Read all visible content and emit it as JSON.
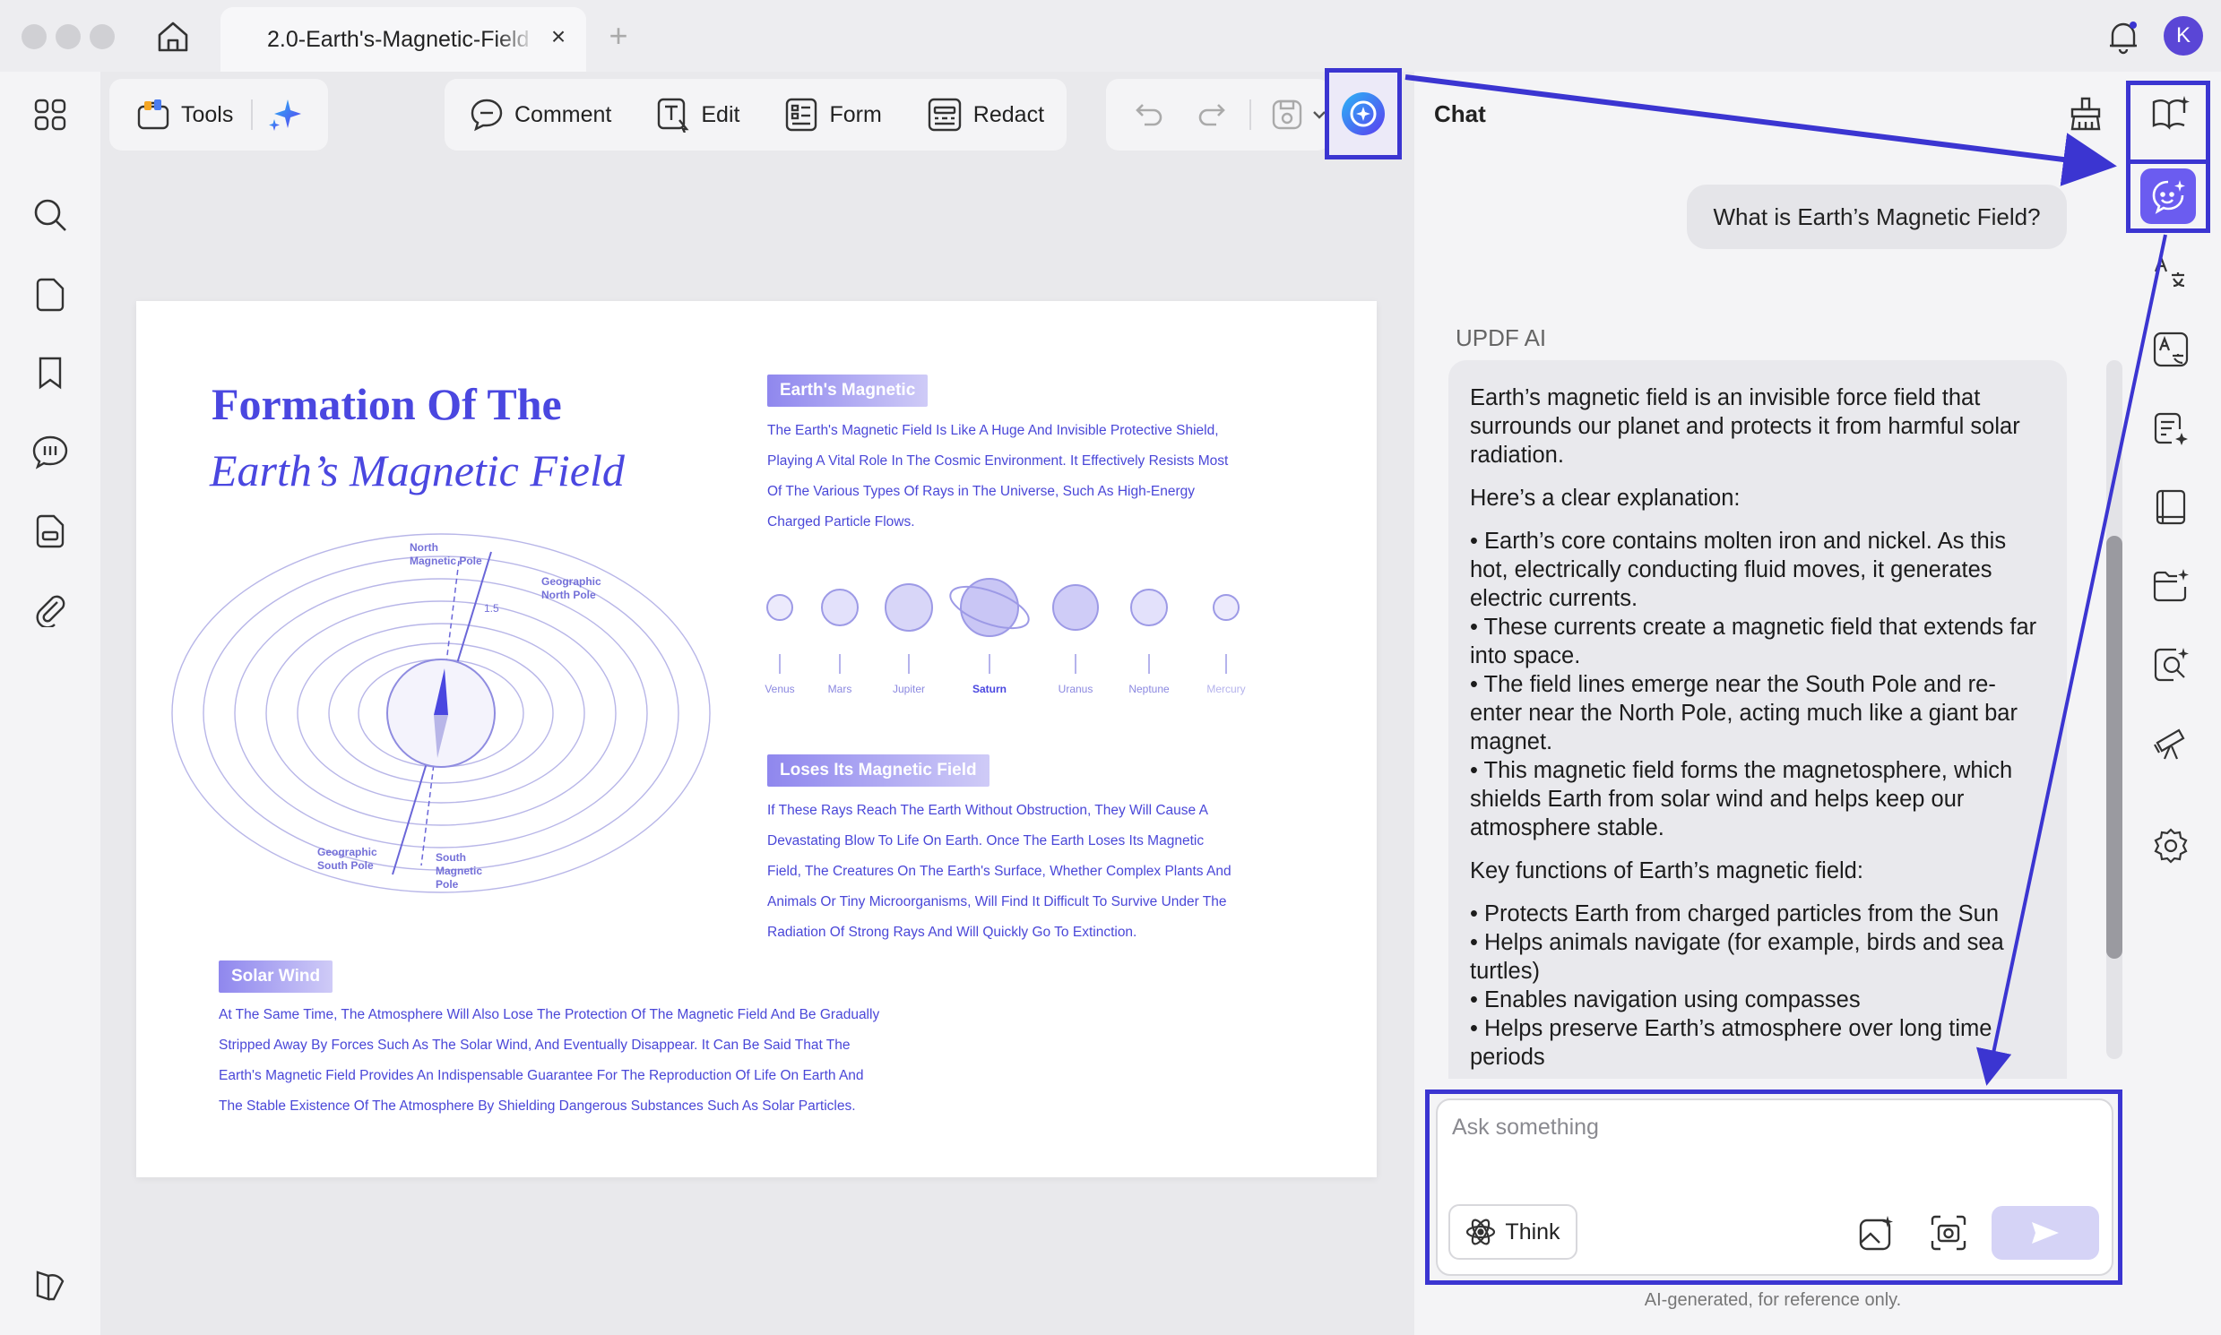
{
  "tab": {
    "title": "2.0-Earth's-Magnetic-Field",
    "close": "×",
    "add": "+"
  },
  "user": {
    "initial": "K"
  },
  "toolbar": {
    "tools_label": "Tools",
    "comment_label": "Comment",
    "edit_label": "Edit",
    "form_label": "Form",
    "redact_label": "Redact"
  },
  "document": {
    "title_line1": "Formation Of The",
    "title_line2": "Earth’s Magnetic Field",
    "sections": [
      {
        "label": "Earth's Magnetic",
        "lines": [
          "The Earth's Magnetic Field Is Like A Huge And Invisible Protective Shield,",
          "Playing A Vital Role In The Cosmic Environment. It Effectively Resists Most",
          "Of The Various Types Of Rays in The Universe, Such As High-Energy",
          "Charged Particle Flows."
        ]
      },
      {
        "label": "Loses Its Magnetic Field",
        "lines": [
          "If These Rays Reach The Earth Without Obstruction, They Will Cause A",
          "Devastating Blow To Life On Earth. Once The Earth Loses Its Magnetic",
          "Field, The Creatures On The Earth's Surface, Whether Complex Plants And",
          "Animals Or Tiny Microorganisms, Will Find It Difficult To Survive Under The",
          "Radiation Of Strong Rays And Will Quickly Go To Extinction."
        ]
      },
      {
        "label": "Solar Wind",
        "lines": [
          "At The Same Time, The Atmosphere Will Also Lose The Protection Of The Magnetic Field And Be Gradually",
          "Stripped Away By Forces Such As The Solar Wind, And Eventually Disappear. It Can Be Said That The",
          "Earth's Magnetic Field Provides An Indispensable Guarantee For The Reproduction Of Life On Earth And",
          "The Stable Existence Of The Atmosphere By Shielding Dangerous Substances Such As Solar Particles."
        ]
      }
    ],
    "planets": [
      "Venus",
      "Mars",
      "Jupiter",
      "Saturn",
      "Uranus",
      "Neptune",
      "Mercury"
    ],
    "diagram_labels": {
      "north_magnetic": [
        "North",
        "Magnetic Pole"
      ],
      "geo_north": [
        "Geographic",
        "North Pole"
      ],
      "geo_south": [
        "Geographic",
        "South Pole"
      ],
      "south_magnetic": [
        "South",
        "Magnetic",
        "Pole"
      ],
      "angle": "1.5"
    }
  },
  "chat": {
    "title": "Chat",
    "user_question": "What is Earth’s Magnetic Field?",
    "ai_sender": "UPDF AI",
    "ai_intro": "Earth’s magnetic field is an invisible force field that surrounds our planet and protects it from harmful solar radiation.",
    "ai_explain_heading": "Here’s a clear explanation:",
    "ai_bullets": [
      "• Earth’s core contains molten iron and nickel. As this hot, electrically conducting fluid moves, it generates electric currents.",
      "• These currents create a magnetic field that extends far into space.",
      "• The field lines emerge near the South Pole and re-enter near the North Pole, acting much like a giant bar magnet.",
      "• This magnetic field forms the magnetosphere, which shields Earth from solar wind and helps keep our atmosphere stable."
    ],
    "ai_functions_heading": "Key functions of Earth’s magnetic field:",
    "ai_functions": [
      "• Protects Earth from charged particles from the Sun",
      "• Helps animals navigate (for example, birds and sea turtles)",
      "• Enables navigation using compasses",
      "• Helps preserve Earth’s atmosphere over long time periods"
    ],
    "input_placeholder": "Ask something",
    "think_label": "Think",
    "disclaimer": "AI-generated, for reference only."
  },
  "colors": {
    "accent": "#3b35d1",
    "doc_blue": "#4a47e0",
    "ai_purple": "#6b5cf0"
  }
}
